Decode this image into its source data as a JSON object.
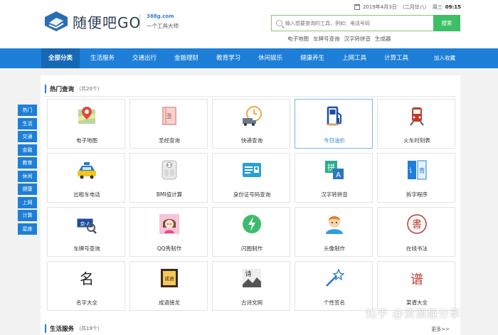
{
  "header": {
    "logo_text": "随便吧GO",
    "slogan_domain": "388g.com",
    "slogan_text": "一个工具大师",
    "date": "2019年4月3日",
    "lunar": "（二月廿八）",
    "weekday": "周三",
    "time": "09:15"
  },
  "search": {
    "placeholder": "输入想要查询的工具，例如：电话号码",
    "button_label": "搜索",
    "quick_links": [
      "电子地图",
      "车牌号查询",
      "汉字转拼音",
      "生成器"
    ]
  },
  "nav": {
    "items": [
      "全部分类",
      "生活服务",
      "交通出行",
      "金融理财",
      "教育学习",
      "休闲娱乐",
      "健康养生",
      "上网工具",
      "计算工具"
    ],
    "favorite_label": "加入收藏"
  },
  "side_nav": [
    "热门",
    "生活",
    "交通",
    "金融",
    "教育",
    "休闲",
    "健康",
    "上网",
    "计算",
    "星座"
  ],
  "hot": {
    "title": "热门查询",
    "count": "（共20个）",
    "tools": [
      {
        "label": "电子地图",
        "icon": "map-pin-icon"
      },
      {
        "label": "圣经查询",
        "icon": "bible-book-icon"
      },
      {
        "label": "快递查询",
        "icon": "delivery-truck-clock-icon"
      },
      {
        "label": "今日油价",
        "icon": "fuel-pump-icon",
        "selected": true
      },
      {
        "label": "火车时刻表",
        "icon": "train-icon"
      },
      {
        "label": "出租车电话",
        "icon": "taxi-icon"
      },
      {
        "label": "BMI值计算",
        "icon": "bmi-scale-icon"
      },
      {
        "label": "身份证号码查询",
        "icon": "id-card-icon"
      },
      {
        "label": "汉字转拼音",
        "icon": "pinyin-icon"
      },
      {
        "label": "拆字程序",
        "icon": "split-character-icon"
      },
      {
        "label": "车牌号查询",
        "icon": "license-plate-icon"
      },
      {
        "label": "QQ秀制作",
        "icon": "qq-show-avatar-icon"
      },
      {
        "label": "闪图制作",
        "icon": "lightning-icon"
      },
      {
        "label": "头像制作",
        "icon": "avatar-icon"
      },
      {
        "label": "在线书法",
        "icon": "calligraphy-seal-icon"
      },
      {
        "label": "名字大全",
        "icon": "name-character-icon"
      },
      {
        "label": "成语接龙",
        "icon": "idiom-book-icon"
      },
      {
        "label": "古诗文网",
        "icon": "ancient-poem-icon"
      },
      {
        "label": "个性签名",
        "icon": "signature-wand-icon"
      },
      {
        "label": "菜谱大全",
        "icon": "recipe-icon"
      }
    ],
    "icon_glyphs": {
      "bible": "圣",
      "pinyin": "拼",
      "pinyin_small": "A",
      "split_char": "青",
      "split_left": "讠",
      "plate": "京·A",
      "calligraphy": "書",
      "name_char": "名",
      "idiom": "成语",
      "poem": "诗",
      "recipe": "谱"
    }
  },
  "life": {
    "title": "生活服务",
    "count": "（共19个）",
    "more_label": "更多>>"
  },
  "watermark": "知乎 @资源趣分享",
  "colors": {
    "brand_blue": "#1d7fd7",
    "search_green": "#3fbf65"
  }
}
